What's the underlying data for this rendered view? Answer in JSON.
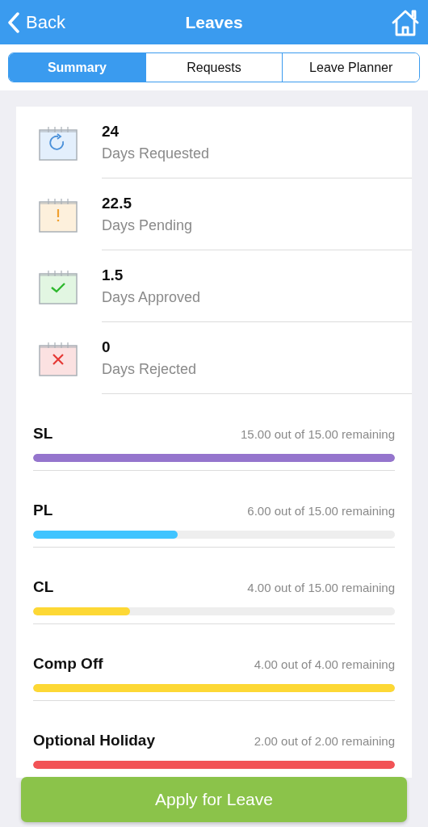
{
  "nav": {
    "back": "Back",
    "title": "Leaves"
  },
  "tabs": [
    {
      "label": "Summary",
      "selected": true
    },
    {
      "label": "Requests",
      "selected": false
    },
    {
      "label": "Leave Planner",
      "selected": false
    }
  ],
  "stats": [
    {
      "kind": "requested",
      "value": "24",
      "label": "Days Requested"
    },
    {
      "kind": "pending",
      "value": "22.5",
      "label": "Days Pending"
    },
    {
      "kind": "approved",
      "value": "1.5",
      "label": "Days Approved"
    },
    {
      "kind": "rejected",
      "value": "0",
      "label": "Days Rejected"
    }
  ],
  "balances": [
    {
      "name": "SL",
      "reading": "15.00 out of 15.00 remaining",
      "level": 1,
      "color": "#9575cd"
    },
    {
      "name": "PL",
      "reading": "6.00 out of 15.00 remaining",
      "level": 0.4,
      "color": "#40c4ff"
    },
    {
      "name": "CL",
      "reading": "4.00 out of 15.00 remaining",
      "level": 0.267,
      "color": "#fdd835"
    },
    {
      "name": "Comp Off",
      "reading": "4.00 out of 4.00 remaining",
      "level": 1,
      "color": "#fdd835"
    },
    {
      "name": "Optional Holiday",
      "reading": "2.00 out of 2.00 remaining",
      "level": 1,
      "color": "#f25356"
    }
  ],
  "apply_button": "Apply for Leave"
}
